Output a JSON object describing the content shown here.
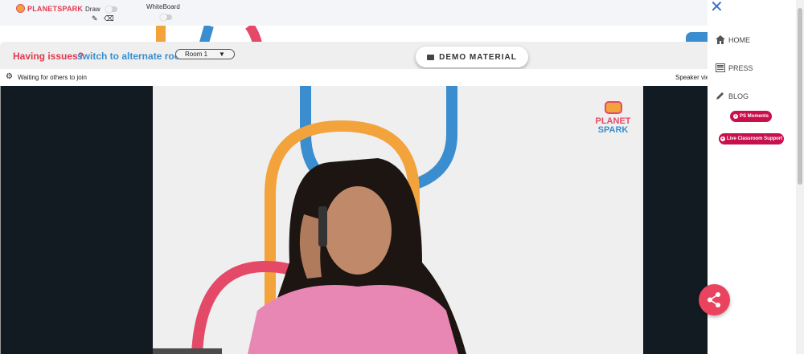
{
  "brand": {
    "name": "PLANETSPARK",
    "logo_line1": "PLANET",
    "logo_line2": "SPARK"
  },
  "toolbar": {
    "draw_label": "Draw",
    "whiteboard_label": "WhiteBoard",
    "pencil_icon": "pencil-icon",
    "eraser_icon": "eraser-icon"
  },
  "issue": {
    "prefix": "Having issues?",
    "link": "switch to alternate room",
    "room_selected": "Room 1"
  },
  "demo": {
    "label": "DEMO MATERIAL"
  },
  "panel": {
    "status": "Waiting for others to join",
    "view_mode": "Speaker view"
  },
  "sidebar": {
    "items": [
      {
        "label": "HOME",
        "icon": "home-icon"
      },
      {
        "label": "PRESS",
        "icon": "newspaper-icon"
      },
      {
        "label": "BLOG",
        "icon": "pencil-icon"
      }
    ],
    "pills": [
      {
        "label": "PS Moments"
      },
      {
        "label": "Live Classroom Support"
      }
    ]
  },
  "colors": {
    "brand_red": "#e0384f",
    "brand_blue": "#3a8ecf",
    "brand_yellow": "#f3a33c",
    "pill": "#c8104d",
    "video_dark": "#131b22"
  }
}
